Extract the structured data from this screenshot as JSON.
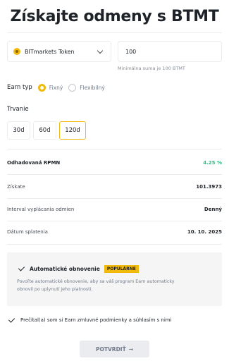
{
  "page": {
    "title": "Získajte odmeny s BTMT"
  },
  "token_select": {
    "value": "BITmarkets Token",
    "icon": "coin-icon"
  },
  "amount": {
    "value": "100",
    "min_note": "Minimálna suma je 100 BTMT"
  },
  "earn_type": {
    "label": "Earn typ",
    "options": [
      {
        "label": "Fixný",
        "selected": true
      },
      {
        "label": "Flexibilný",
        "selected": false
      }
    ]
  },
  "duration": {
    "label": "Trvanie",
    "options": [
      "30d",
      "60d",
      "120d"
    ],
    "selected": "120d"
  },
  "summary": {
    "apr_label": "Odhadovaná RPMN",
    "apr_value": "4.25 %",
    "receive_label": "Získate",
    "receive_value": "101.3973",
    "interval_label": "Interval vyplácania odmien",
    "interval_value": "Denný",
    "maturity_label": "Dátum splatenia",
    "maturity_value": "10. 10. 2025"
  },
  "auto_renew": {
    "title": "Automatické obnovenie",
    "badge": "POPULÁRNE",
    "description_line1": "Povoľte automatické obnovenie, aby sa váš program Earn automaticky",
    "description_line2": "obnovil po uplynutí jeho platnosti."
  },
  "agreement": {
    "text": "Prečítal(a) som si Earn zmluvné podmienky a súhlasím s nimi"
  },
  "confirm": {
    "label": "POTVRDIŤ",
    "arrow": "→"
  },
  "colors": {
    "accent": "#f0b90b",
    "positive": "#2ebd85",
    "panel": "#f5f5f5"
  }
}
